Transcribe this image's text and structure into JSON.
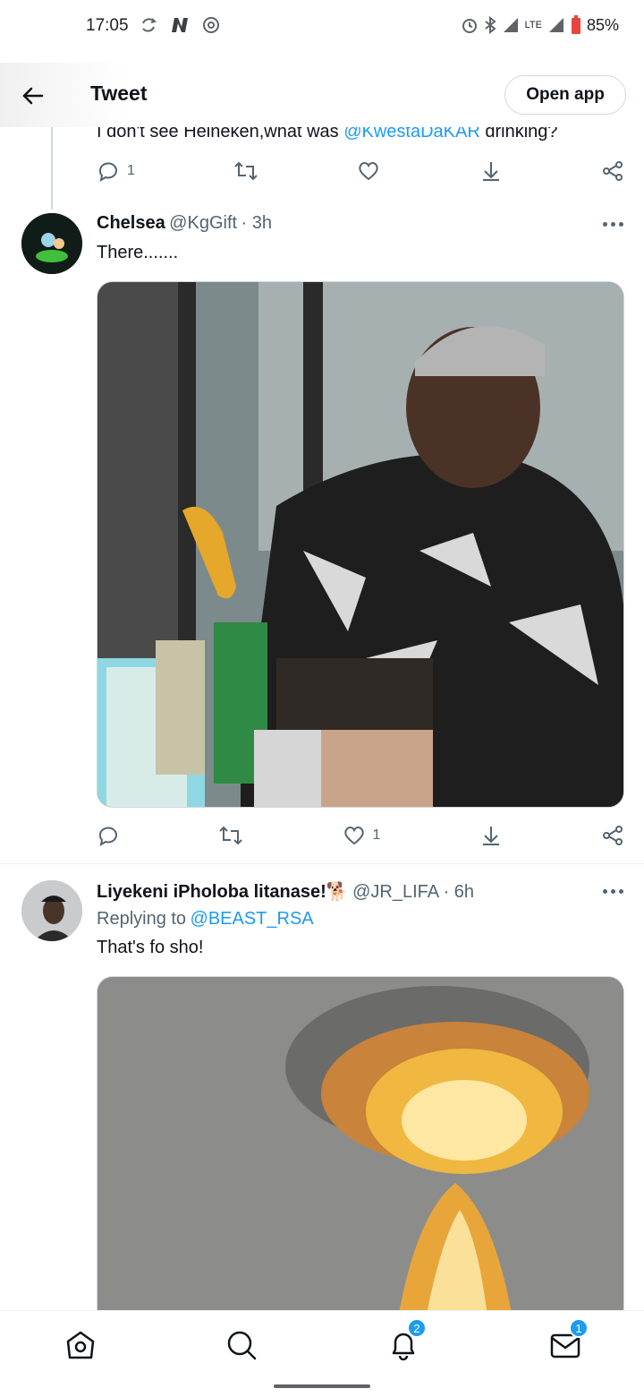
{
  "status_bar": {
    "time": "17:05",
    "network": "LTE",
    "battery": "85%",
    "icons": [
      "sync-icon",
      "n-app-icon",
      "chrome-icon",
      "alarm-icon",
      "bluetooth-icon",
      "signal-icon",
      "battery-icon"
    ]
  },
  "header": {
    "title": "Tweet",
    "open_app": "Open app"
  },
  "partial_tweet": {
    "text_before": "I don't see Heineken,what was ",
    "mention": "@KwestaDaKAR",
    "text_after": " drinking?",
    "reply_count": "1"
  },
  "tweets": [
    {
      "name": "Chelsea",
      "handle": "@KgGift",
      "time": "· 3h",
      "text": "There.......",
      "reply_count": "",
      "like_count": "1"
    },
    {
      "name": "Liyekeni iPholoba litanase!",
      "emoji": "🐕",
      "handle": "@JR_LIFA",
      "time": "· 6h",
      "replying_label": "Replying to",
      "replying_to": "@BEAST_RSA",
      "text": "That's fo sho!"
    }
  ],
  "bottom_nav": {
    "notifications_badge": "2",
    "messages_badge": "1"
  },
  "colors": {
    "accent": "#1d9bf0",
    "text": "#0f1419",
    "secondary": "#536471"
  }
}
